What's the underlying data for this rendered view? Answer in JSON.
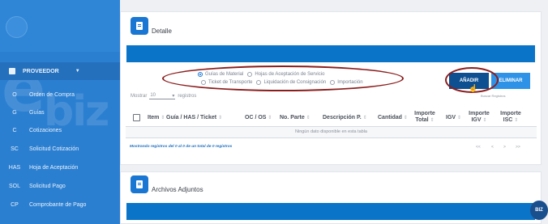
{
  "sidebar": {
    "section": "PROVEEDOR",
    "items": [
      {
        "abbr": "O",
        "label": "Orden de Compra"
      },
      {
        "abbr": "G",
        "label": "Guías"
      },
      {
        "abbr": "C",
        "label": "Cotizaciones"
      },
      {
        "abbr": "SC",
        "label": "Solicitud Cotización"
      },
      {
        "abbr": "HAS",
        "label": "Hoja de Aceptación"
      },
      {
        "abbr": "SOL",
        "label": "Solicitud Pago"
      },
      {
        "abbr": "CP",
        "label": "Comprobante de Pago"
      }
    ],
    "icons": {
      "section": "document-icon",
      "caret": "caret-down-icon"
    }
  },
  "detalle": {
    "title": "Detalle",
    "radio_options": [
      {
        "label": "Guías de Material",
        "checked": true
      },
      {
        "label": "Hojas de Aceptación de Servicio",
        "checked": false
      },
      {
        "label": "Ticket de Transporte",
        "checked": false
      },
      {
        "label": "Liquidación de Consignación",
        "checked": false
      },
      {
        "label": "Importación",
        "checked": false
      }
    ],
    "add_button": "AÑADIR",
    "delete_button": "ELIMINAR",
    "search_placeholder": "Buscar Registros",
    "show": {
      "prefix": "Mostrar",
      "value": "10",
      "suffix": "registros"
    },
    "table": {
      "columns": [
        "Item",
        "Guía / HAS / Ticket",
        "OC / OS",
        "No. Parte",
        "Descripción P.",
        "Cantidad",
        "Importe Total",
        "IGV",
        "Importe IGV",
        "Importe ISC"
      ],
      "empty_message": "Ningún dato disponible en esta tabla",
      "info": "Mostrando registros del 0 al 0 de un total de 0 registros",
      "pager": [
        "<<",
        "<",
        ">",
        ">>"
      ]
    }
  },
  "adjuntos": {
    "title": "Archivos Adjuntos"
  },
  "chat_badge": "BIZ",
  "colors": {
    "sidebar": "#2b7fd1",
    "primary_bar": "#0a74c9",
    "add_button": "#0d4f91",
    "delete_button": "#2e93e6",
    "highlight_ring": "#8b1d1d"
  }
}
